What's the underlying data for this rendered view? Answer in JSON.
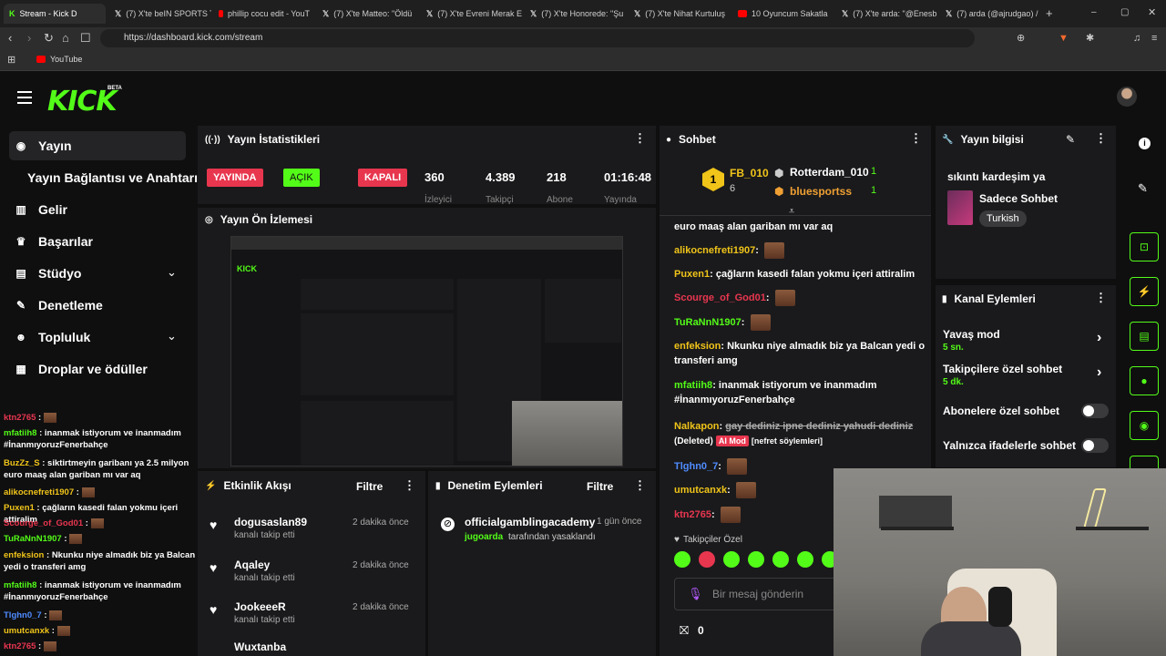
{
  "browser": {
    "tabs": [
      {
        "label": "Stream - Kick D",
        "icon": "kick-icon"
      },
      {
        "label": "(7) X'te beIN SPORTS T",
        "icon": "x-icon"
      },
      {
        "label": "phillip cocu edit - YouT",
        "icon": "youtube-icon"
      },
      {
        "label": "(7) X'te Matteo: \"Öldü",
        "icon": "x-icon"
      },
      {
        "label": "(7) X'te Evreni Merak E",
        "icon": "x-icon"
      },
      {
        "label": "(7) X'te Honorede: \"Şu",
        "icon": "x-icon"
      },
      {
        "label": "(7) X'te Nihat Kurtuluş",
        "icon": "x-icon"
      },
      {
        "label": "10 Oyuncum Sakatla",
        "icon": "youtube-icon"
      },
      {
        "label": "(7) X'te arda: \"@Enesb",
        "icon": "x-icon"
      },
      {
        "label": "(7) arda (@ajrudgao) /",
        "icon": "x-icon"
      }
    ],
    "url": "https://dashboard.kick.com/stream",
    "bookmark": "YouTube"
  },
  "kick": {
    "logo": "KICK",
    "beta": "BETA"
  },
  "sidebar": {
    "items": [
      {
        "label": "Yayın",
        "icon": "broadcast-icon"
      },
      {
        "label": "Yayın Bağlantısı ve Anahtarı",
        "icon": ""
      },
      {
        "label": "Gelir",
        "icon": "chart-icon"
      },
      {
        "label": "Başarılar",
        "icon": "trophy-icon"
      },
      {
        "label": "Stüdyo",
        "icon": "studio-icon"
      },
      {
        "label": "Denetleme",
        "icon": "wrench-icon"
      },
      {
        "label": "Topluluk",
        "icon": "people-icon"
      },
      {
        "label": "Droplar ve ödüller",
        "icon": "drops-icon"
      }
    ]
  },
  "stats": {
    "title": "Yayın İstatistikleri",
    "live": "YAYINDA",
    "open": "AÇIK",
    "closed": "KAPALI",
    "values": [
      "360",
      "4.389",
      "218",
      "01:16:48"
    ],
    "labels": [
      "İzleyici",
      "Takipçi",
      "Abone",
      "Yayında"
    ]
  },
  "preview": {
    "title": "Yayın Ön İzlemesi"
  },
  "activity": {
    "title": "Etkinlik Akışı",
    "filter": "Filtre",
    "items": [
      {
        "name": "dogusaslan89",
        "sub": "kanalı takip etti",
        "time": "2 dakika önce"
      },
      {
        "name": "Aqaley",
        "sub": "kanalı takip etti",
        "time": "2 dakika önce"
      },
      {
        "name": "JookeeeR",
        "sub": "kanalı takip etti",
        "time": "2 dakika önce"
      },
      {
        "name": "Wuxtanba",
        "sub": "",
        "time": ""
      }
    ]
  },
  "moderation": {
    "title": "Denetim Eylemleri",
    "filter": "Filtre",
    "item": {
      "name": "officialgamblingacademy",
      "time": "1 gün önce",
      "by": "jugoarda",
      "action": "tarafından yasaklandı"
    }
  },
  "chat": {
    "title": "Sohbet",
    "top": [
      {
        "rank": "1",
        "name": "FB_010",
        "count": "6"
      },
      {
        "name": "Rotterdam_010",
        "count": "1"
      },
      {
        "name": "bluesportss",
        "count": "1"
      }
    ],
    "messages": [
      {
        "user": "",
        "text": "euro maaş alan gariban mı var aq",
        "color": "#ffffff"
      },
      {
        "user": "alikocnefreti1907",
        "text": "",
        "color": "#f0c419"
      },
      {
        "user": "Puxen1",
        "text": "çağların kasedi falan yokmu içeri attiralim",
        "color": "#f0c419"
      },
      {
        "user": "Scourge_of_God01",
        "text": "",
        "color": "#e8364f"
      },
      {
        "user": "TuRaNnN1907",
        "text": "",
        "color": "#53fc18"
      },
      {
        "user": "enfeksion",
        "text": "Nkunku niye almadık biz ya Balcan yedi o transferi amg",
        "color": "#f0c419"
      },
      {
        "user": "mfatiih8",
        "text": "inanmak istiyorum ve inanmadım #İnanmıyoruzFenerbahçe",
        "color": "#53fc18"
      },
      {
        "user": "Nalkapon",
        "text": "gay dediniz ipne dediniz yahudi dediniz",
        "deleted": "(Deleted)",
        "tag": "AI Mod",
        "reason": "[nefret söylemleri]",
        "color": "#f0c419"
      },
      {
        "user": "Tlghn0_7",
        "text": "",
        "color": "#4f8cff"
      },
      {
        "user": "umutcanxk",
        "text": "",
        "color": "#f0c419"
      },
      {
        "user": "ktn2765",
        "text": "",
        "color": "#e8364f"
      }
    ],
    "followers_label": "Takipçiler Özel",
    "placeholder": "Bir mesaj gönderin",
    "gift_count": "0"
  },
  "overlay_chat": [
    {
      "user": "ktn2765",
      "text": "",
      "color": "#e8364f"
    },
    {
      "user": "mfatiih8",
      "text": "inanmak istiyorum ve inanmadım #İnanmıyoruzFenerbahçe",
      "color": "#53fc18"
    },
    {
      "user": "BuzZz_S",
      "text": "siktirtmeyin garibanı ya 2.5 milyon euro maaş alan gariban mı var aq",
      "color": "#f0c419"
    },
    {
      "user": "alikocnefreti1907",
      "text": "",
      "color": "#f0c419"
    },
    {
      "user": "Puxen1",
      "text": "çağların kasedi falan yokmu içeri attiralim",
      "color": "#f0c419"
    },
    {
      "user": "Scourge_of_God01",
      "text": "",
      "color": "#e8364f"
    },
    {
      "user": "TuRaNnN1907",
      "text": "",
      "color": "#53fc18"
    },
    {
      "user": "enfeksion",
      "text": "Nkunku niye almadık biz ya Balcan yedi o transferi amg",
      "color": "#f0c419"
    },
    {
      "user": "mfatiih8",
      "text": "inanmak istiyorum ve inanmadım #İnanmıyoruzFenerbahçe",
      "color": "#53fc18"
    },
    {
      "user": "Tlghn0_7",
      "text": "",
      "color": "#4f8cff"
    },
    {
      "user": "umutcanxk",
      "text": "",
      "color": "#f0c419"
    },
    {
      "user": "ktn2765",
      "text": "",
      "color": "#e8364f"
    }
  ],
  "stream_info": {
    "title": "Yayın bilgisi",
    "stream_title": "sıkıntı kardeşim ya",
    "category": "Sadece Sohbet",
    "language": "Turkish"
  },
  "channel_actions": {
    "title": "Kanal Eylemleri",
    "items": [
      {
        "label": "Yavaş mod",
        "value": "5 sn."
      },
      {
        "label": "Takipçilere özel sohbet",
        "value": "5 dk."
      },
      {
        "label": "Abonelere özel sohbet",
        "value": ""
      },
      {
        "label": "Yalnızca ifadelerle sohbet",
        "value": ""
      }
    ]
  },
  "colors": {
    "accent": "#53fc18",
    "live": "#e8364f",
    "panel": "#1a1a1c"
  }
}
